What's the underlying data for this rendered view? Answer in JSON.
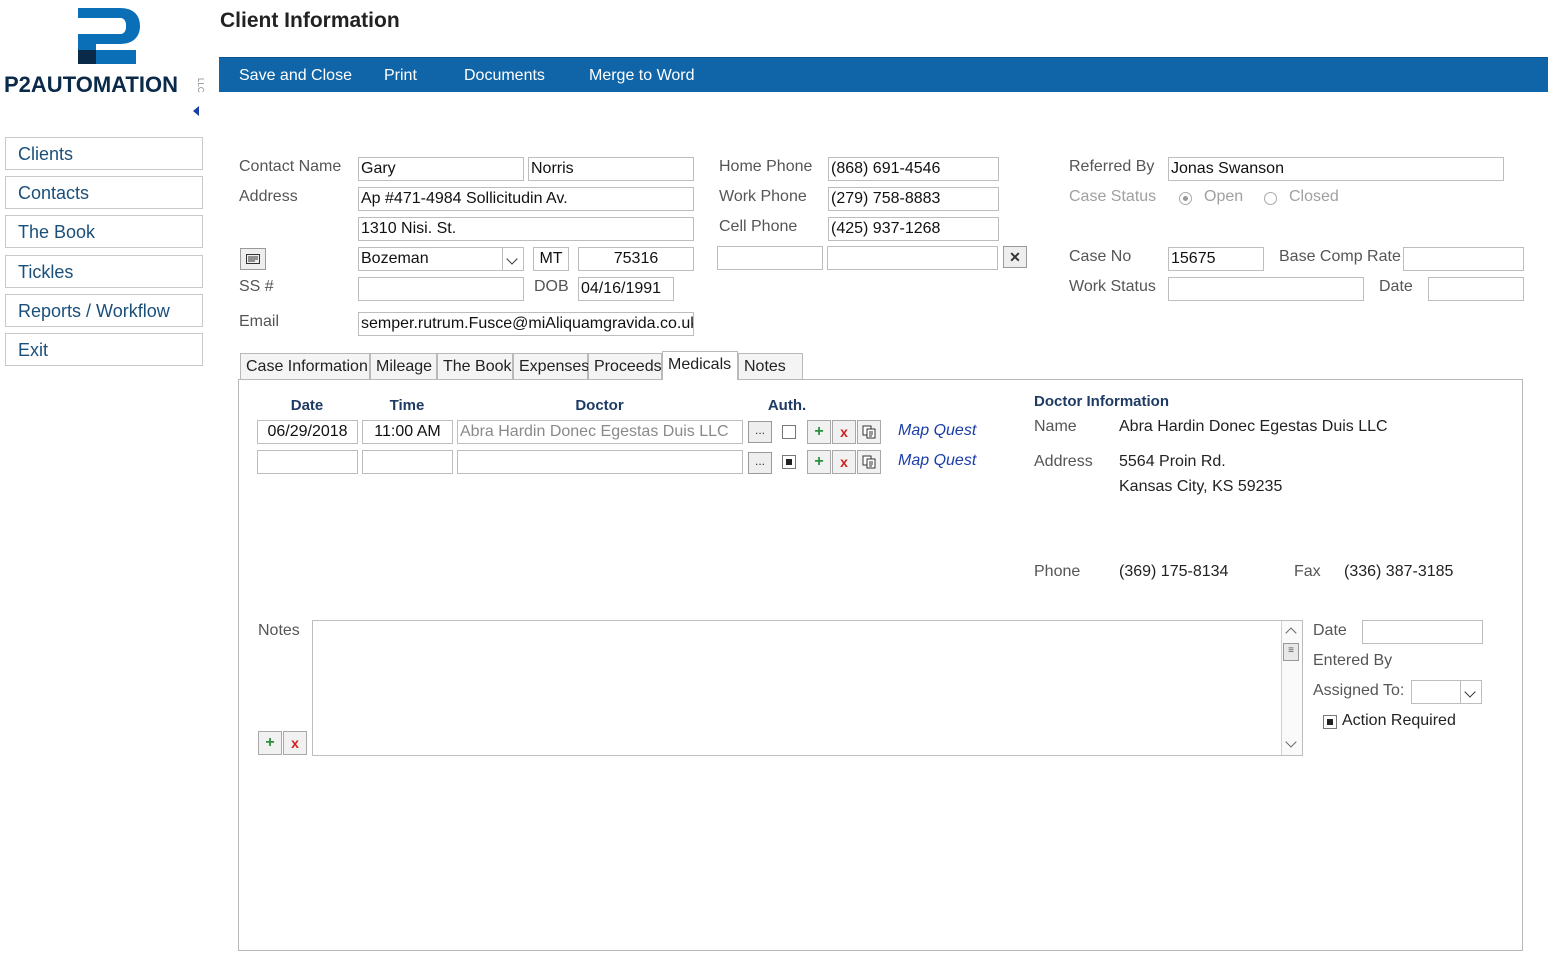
{
  "logo": {
    "text_p2": "P2",
    "text_rest": "AUTOMATION",
    "small": "LLC"
  },
  "sidebar": {
    "items": [
      {
        "label": "Clients"
      },
      {
        "label": "Contacts"
      },
      {
        "label": "The Book"
      },
      {
        "label": "Tickles"
      },
      {
        "label": "Reports / Workflow"
      },
      {
        "label": "Exit"
      }
    ]
  },
  "header": {
    "title": "Client Information"
  },
  "toolbar": {
    "save_close": "Save and Close",
    "print": "Print",
    "documents": "Documents",
    "merge": "Merge to Word",
    "color": "#1065a8"
  },
  "contact": {
    "name_label": "Contact Name",
    "first_name": "Gary",
    "last_name": "Norris",
    "address_label": "Address",
    "address1": "Ap #471-4984 Sollicitudin Av.",
    "address2": "1310 Nisi. St.",
    "city": "Bozeman",
    "state": "MT",
    "zip": "75316",
    "ss_label": "SS #",
    "ss": "",
    "dob_label": "DOB",
    "dob": "04/16/1991",
    "email_label": "Email",
    "email": "semper.rutrum.Fusce@miAliquamgravida.co.uk"
  },
  "phones": {
    "home_label": "Home Phone",
    "home": "(868) 691-4546",
    "work_label": "Work Phone",
    "work": "(279) 758-8883",
    "cell_label": "Cell Phone",
    "cell": "(425) 937-1268",
    "extra1": "",
    "extra2": ""
  },
  "case": {
    "referred_label": "Referred By",
    "referred": "Jonas Swanson",
    "status_label": "Case Status",
    "status_open": "Open",
    "status_closed": "Closed",
    "selected_status": "Open",
    "case_no_label": "Case No",
    "case_no": "15675",
    "base_comp_label": "Base Comp Rate",
    "base_comp": "",
    "work_status_label": "Work Status",
    "work_status": "",
    "date_label": "Date",
    "date": ""
  },
  "tabs": [
    {
      "label": "Case Information"
    },
    {
      "label": "Mileage"
    },
    {
      "label": "The Book"
    },
    {
      "label": "Expenses"
    },
    {
      "label": "Proceeds"
    },
    {
      "label": "Medicals",
      "active": true
    },
    {
      "label": "Notes"
    }
  ],
  "medicals": {
    "headers": {
      "date": "Date",
      "time": "Time",
      "doctor": "Doctor",
      "auth": "Auth."
    },
    "rows": [
      {
        "date": "06/29/2018",
        "time": "11:00 AM",
        "doctor": "Abra Hardin   Donec Egestas Duis LLC",
        "auth": false,
        "map": "Map Quest",
        "ellipsis": "..."
      },
      {
        "date": "",
        "time": "",
        "doctor": "",
        "auth": true,
        "map": "Map Quest",
        "ellipsis": "..."
      }
    ]
  },
  "doctor_info": {
    "title": "Doctor Information",
    "name_label": "Name",
    "name": "Abra Hardin   Donec Egestas Duis LLC",
    "address_label": "Address",
    "address1": "5564 Proin Rd.",
    "address2": "Kansas City, KS 59235",
    "phone_label": "Phone",
    "phone": "(369) 175-8134",
    "fax_label": "Fax",
    "fax": "(336) 387-3185"
  },
  "notes": {
    "label": "Notes",
    "text": "",
    "date_label": "Date",
    "date": "",
    "entered_by_label": "Entered By",
    "assigned_label": "Assigned To:",
    "assigned": "",
    "action_required_label": "Action Required",
    "action_required": true
  },
  "icons": {
    "plus": "+",
    "delete": "x",
    "clear": "✕",
    "envelope": "envelope-icon",
    "copy": "copy-icon"
  }
}
